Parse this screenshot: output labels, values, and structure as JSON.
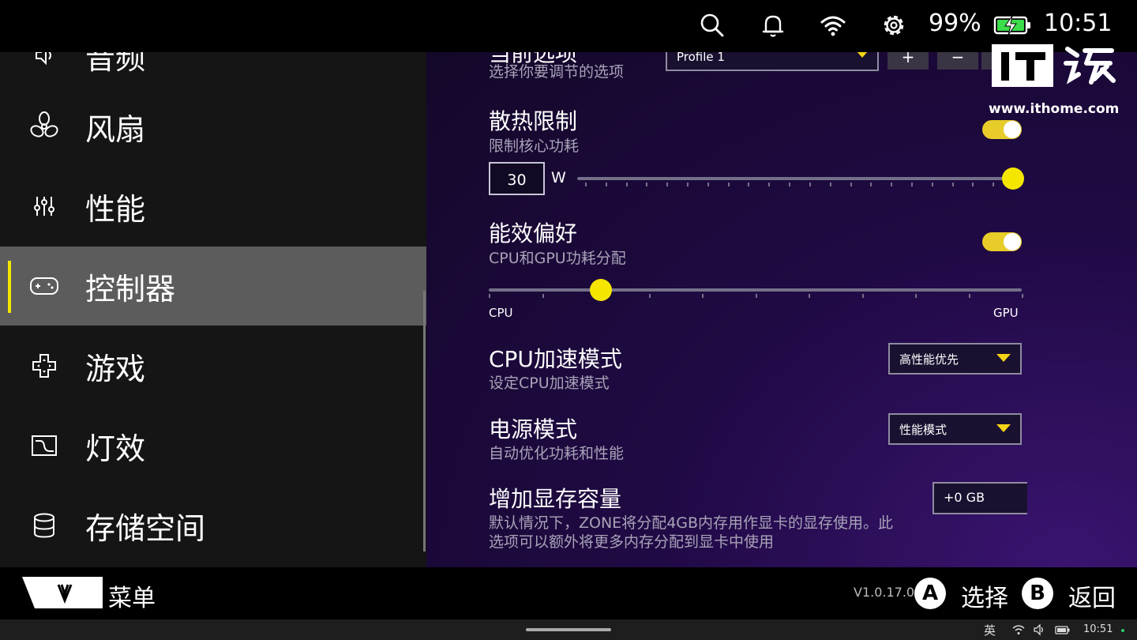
{
  "status_bar": {
    "battery_percent": "99%",
    "time": "10:51",
    "icons": [
      "search-icon",
      "bell-icon",
      "wifi-icon",
      "gear-icon",
      "battery-charging-icon"
    ],
    "battery_color": "#3ddc4a"
  },
  "sidebar": {
    "items": [
      {
        "label": "音频",
        "icon": "audio-icon"
      },
      {
        "label": "风扇",
        "icon": "fan-icon"
      },
      {
        "label": "性能",
        "icon": "sliders-icon"
      },
      {
        "label": "控制器",
        "icon": "gamepad-icon",
        "active": true
      },
      {
        "label": "游戏",
        "icon": "dpad-icon"
      },
      {
        "label": "灯效",
        "icon": "light-effect-icon"
      },
      {
        "label": "存储空间",
        "icon": "database-icon"
      }
    ],
    "accent_color": "#f5e600"
  },
  "content": {
    "profile": {
      "title": "当前选项",
      "subtitle": "选择你要调节的选项",
      "selected": "Profile 1",
      "add_label": "+",
      "remove_label": "−"
    },
    "thermal_limit": {
      "title": "散热限制",
      "subtitle": "限制核心功耗",
      "enabled": true,
      "value": "30",
      "unit": "W",
      "slider_fraction": 1.0
    },
    "efficiency": {
      "title": "能效偏好",
      "subtitle": "CPU和GPU功耗分配",
      "enabled": true,
      "left_label": "CPU",
      "right_label": "GPU",
      "slider_fraction": 0.21
    },
    "cpu_boost": {
      "title": "CPU加速模式",
      "subtitle": "设定CPU加速模式",
      "selected": "高性能优先"
    },
    "power_mode": {
      "title": "电源模式",
      "subtitle": "自动优化功耗和性能",
      "selected": "性能模式"
    },
    "vram": {
      "title": "增加显存容量",
      "subtitle_line1": "默认情况下，ZONE将分配4GB内存用作显卡的显存使用。此",
      "subtitle_line2": "选项可以额外将更多内存分配到显卡中使用",
      "value": "+0 GB"
    }
  },
  "watermark": {
    "url": "www.ithome.com"
  },
  "bottom_bar": {
    "menu_label": "菜单",
    "version": "V1.0.17.0",
    "a_button": "A",
    "a_label": "选择",
    "b_button": "B",
    "b_label": "返回"
  },
  "taskbar": {
    "ime": "英",
    "time": "10:51"
  }
}
